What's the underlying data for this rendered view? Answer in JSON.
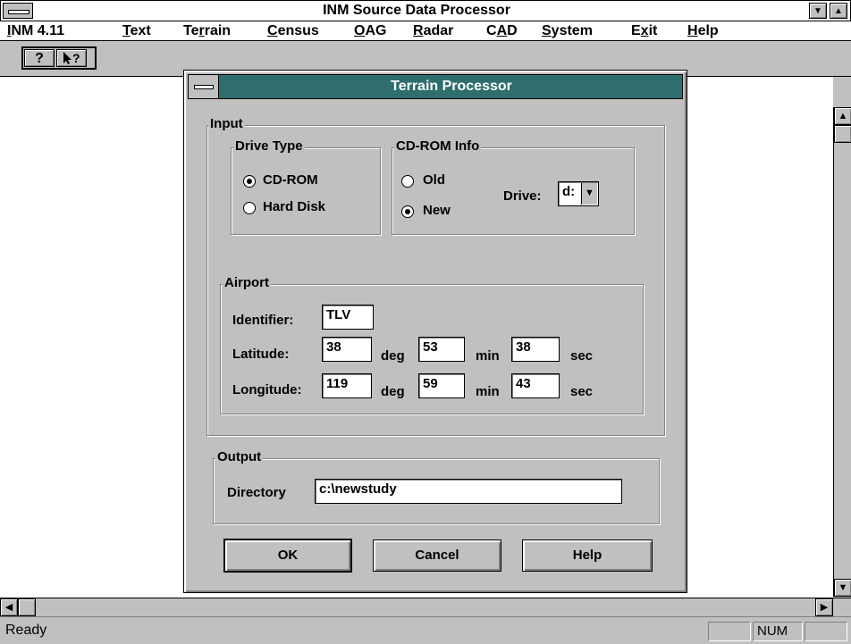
{
  "window": {
    "title": "INM Source Data Processor"
  },
  "menu": {
    "items": [
      {
        "pre": "",
        "acc": "I",
        "post": "NM 4.11"
      },
      {
        "pre": "",
        "acc": "T",
        "post": "ext"
      },
      {
        "pre": "Te",
        "acc": "r",
        "post": "rain"
      },
      {
        "pre": "",
        "acc": "C",
        "post": "ensus"
      },
      {
        "pre": "",
        "acc": "O",
        "post": "AG"
      },
      {
        "pre": "",
        "acc": "R",
        "post": "adar"
      },
      {
        "pre": "C",
        "acc": "A",
        "post": "D"
      },
      {
        "pre": "",
        "acc": "S",
        "post": "ystem"
      },
      {
        "pre": "E",
        "acc": "x",
        "post": "it"
      },
      {
        "pre": "",
        "acc": "H",
        "post": "elp"
      }
    ]
  },
  "toolbar": {
    "help_glyph": "?",
    "context_help_glyph": "?"
  },
  "dialog": {
    "title": "Terrain Processor",
    "input_group": "Input",
    "drive_type": {
      "label": "Drive Type",
      "options": [
        "CD-ROM",
        "Hard Disk"
      ],
      "selected": "CD-ROM"
    },
    "cdrom_info": {
      "label": "CD-ROM Info",
      "options": [
        "Old",
        "New"
      ],
      "selected": "New",
      "drive_label": "Drive:",
      "drive_value": "d:"
    },
    "airport": {
      "label": "Airport",
      "identifier_label": "Identifier:",
      "identifier": "TLV",
      "latitude_label": "Latitude:",
      "lat_deg": "38",
      "lat_min": "53",
      "lat_sec": "38",
      "longitude_label": "Longitude:",
      "lon_deg": "119",
      "lon_min": "59",
      "lon_sec": "43",
      "deg": "deg",
      "min": "min",
      "sec": "sec"
    },
    "output": {
      "label": "Output",
      "directory_label": "Directory",
      "directory": "c:\\newstudy"
    },
    "buttons": {
      "ok": "OK",
      "cancel": "Cancel",
      "help": "Help"
    }
  },
  "status": {
    "text": "Ready",
    "num": "NUM"
  }
}
